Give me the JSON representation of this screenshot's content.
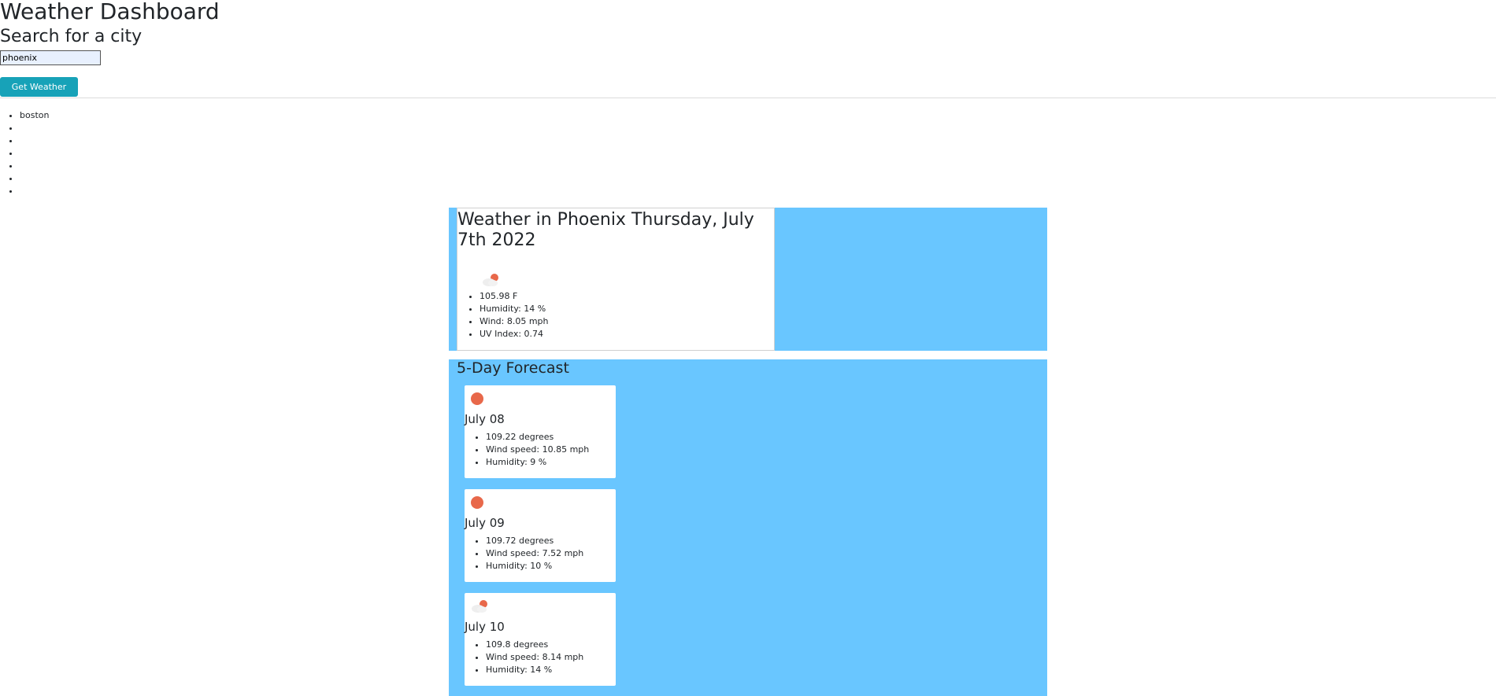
{
  "header": {
    "title": "Weather Dashboard",
    "subtitle": "Search for a city"
  },
  "search": {
    "value": "phoenix",
    "button_label": "Get Weather"
  },
  "history": {
    "items": [
      "boston",
      "",
      "",
      "",
      "",
      "",
      ""
    ]
  },
  "current": {
    "title": "Weather in Phoenix Thursday, July 7th 2022",
    "icon": "partly-cloudy-icon",
    "temp": "105.98 F",
    "humidity": "Humidity: 14 %",
    "wind": "Wind: 8.05 mph",
    "uv": "UV Index: 0.74"
  },
  "forecast": {
    "title": "5-Day Forecast",
    "days": [
      {
        "date": "July 08",
        "icon": "sun-icon",
        "temp": "109.22 degrees",
        "wind": "Wind speed: 10.85 mph",
        "humidity": "Humidity: 9 %"
      },
      {
        "date": "July 09",
        "icon": "sun-icon",
        "temp": "109.72 degrees",
        "wind": "Wind speed: 7.52 mph",
        "humidity": "Humidity: 10 %"
      },
      {
        "date": "July 10",
        "icon": "partly-cloudy-icon",
        "temp": "109.8 degrees",
        "wind": "Wind speed: 8.14 mph",
        "humidity": "Humidity: 14 %"
      }
    ]
  },
  "colors": {
    "panel_background": "#69c6ff",
    "button": "#17a2b8",
    "sun": "#e8684a"
  }
}
